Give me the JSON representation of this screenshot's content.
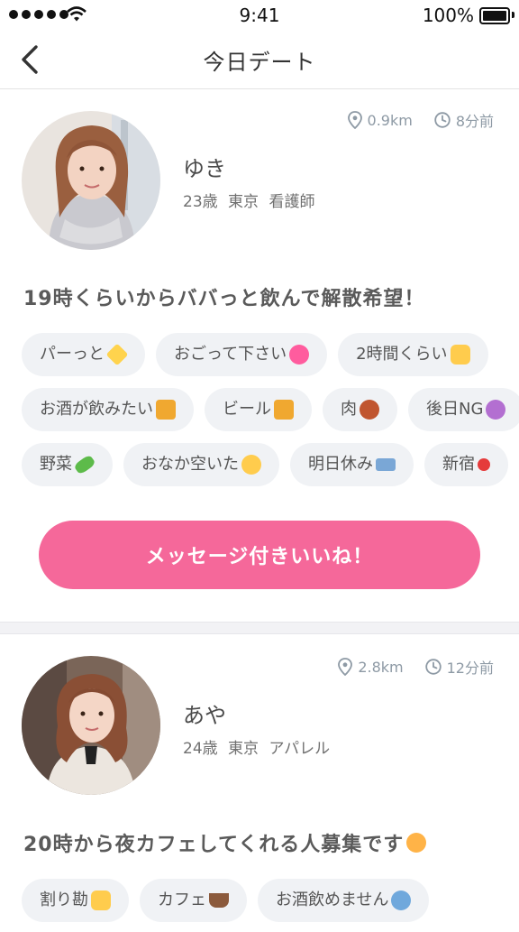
{
  "status_bar": {
    "time": "9:41",
    "battery": "100%"
  },
  "nav": {
    "title": "今日デート"
  },
  "cards": [
    {
      "distance": "0.9km",
      "time_ago": "8分前",
      "name": "ゆき",
      "details": "23歳 東京 看護師",
      "headline": "19時くらいからババっと飲んで解散希望！",
      "tags": [
        [
          "パーっと",
          "おごって下さい",
          "2時間くらい"
        ],
        [
          "お酒が飲みたい",
          "ビール",
          "肉",
          "後日NG"
        ],
        [
          "野菜",
          "おなか空いた",
          "明日休み",
          "新宿"
        ]
      ],
      "cta": "メッセージ付きいいね！"
    },
    {
      "distance": "2.8km",
      "time_ago": "12分前",
      "name": "あや",
      "details": "24歳 東京 アパレル",
      "headline": "20時から夜カフェしてくれる人募集です",
      "tags": [
        [
          "割り勘",
          "カフェ",
          "お酒飲めません"
        ]
      ]
    }
  ],
  "colors": {
    "accent": "#f5689a",
    "tag_bg": "#f0f2f5",
    "meta": "#8e9aa5"
  }
}
